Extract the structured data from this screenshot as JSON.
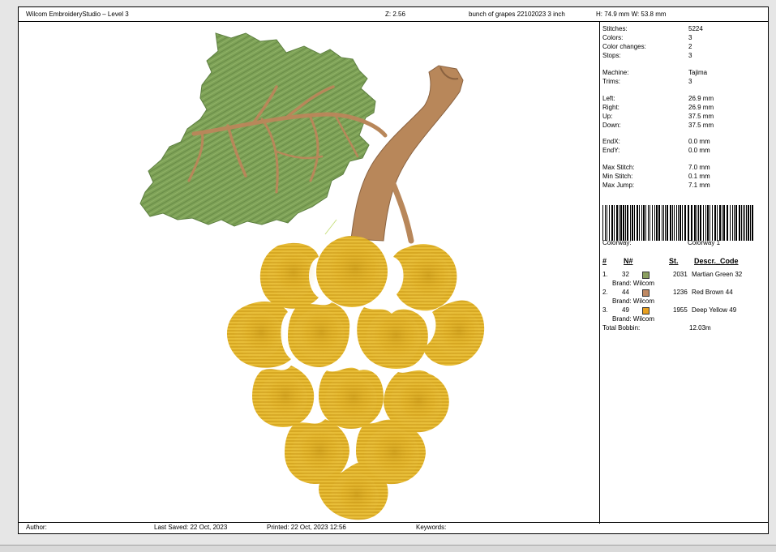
{
  "header": {
    "app_title": "Wilcom EmbroideryStudio – Level 3",
    "zoom": "Z: 2.56",
    "design_name": "bunch of grapes 22102023 3 inch",
    "size": "H: 74.9 mm   W: 53.8 mm"
  },
  "stats": [
    {
      "label": "Stitches:",
      "value": "5224"
    },
    {
      "label": "Colors:",
      "value": "3"
    },
    {
      "label": "Color changes:",
      "value": "2"
    },
    {
      "label": "Stops:",
      "value": "3"
    },
    {
      "label": "Machine:",
      "value": "Tajima"
    },
    {
      "label": "Trims:",
      "value": "3"
    },
    {
      "label": "Left:",
      "value": "26.9 mm"
    },
    {
      "label": "Right:",
      "value": "26.9 mm"
    },
    {
      "label": "Up:",
      "value": "37.5 mm"
    },
    {
      "label": "Down:",
      "value": "37.5 mm"
    },
    {
      "label": "EndX:",
      "value": "0.0 mm"
    },
    {
      "label": "EndY:",
      "value": "0.0 mm"
    },
    {
      "label": "Max Stitch:",
      "value": "7.0 mm"
    },
    {
      "label": "Min Stitch:",
      "value": "0.1 mm"
    },
    {
      "label": "Max Jump:",
      "value": "7.1 mm"
    }
  ],
  "colorway": {
    "label": "Colorway:",
    "value": "Colorway 1"
  },
  "color_table": {
    "headers": {
      "num": "#",
      "n": "N#",
      "st": "St.",
      "descr": "Descr._Code"
    },
    "rows": [
      {
        "idx": "1.",
        "n": "32",
        "st": "2031",
        "descr": "Martian Green 32",
        "brand": "Brand: Wilcom",
        "swatch": "#8ca060"
      },
      {
        "idx": "2.",
        "n": "44",
        "st": "1236",
        "descr": "Red Brown 44",
        "brand": "Brand: Wilcom",
        "swatch": "#c08a64"
      },
      {
        "idx": "3.",
        "n": "49",
        "st": "1955",
        "descr": "Deep Yellow 49",
        "brand": "Brand: Wilcom",
        "swatch": "#e8a020"
      }
    ],
    "total_bobbin_label": "Total Bobbin:",
    "total_bobbin_value": "12.03m"
  },
  "footer": {
    "author": "Author:",
    "last_saved": "Last Saved: 22 Oct, 2023",
    "printed": "Printed: 22 Oct, 2023 12:56",
    "keywords": "Keywords:"
  },
  "colors": {
    "leaf": "#7a9e55",
    "leaf_dark": "#5e8040",
    "stem": "#b8875a",
    "grape": "#e3b52a",
    "grape_dark": "#b88a10",
    "grape_light": "#f3d35a"
  }
}
